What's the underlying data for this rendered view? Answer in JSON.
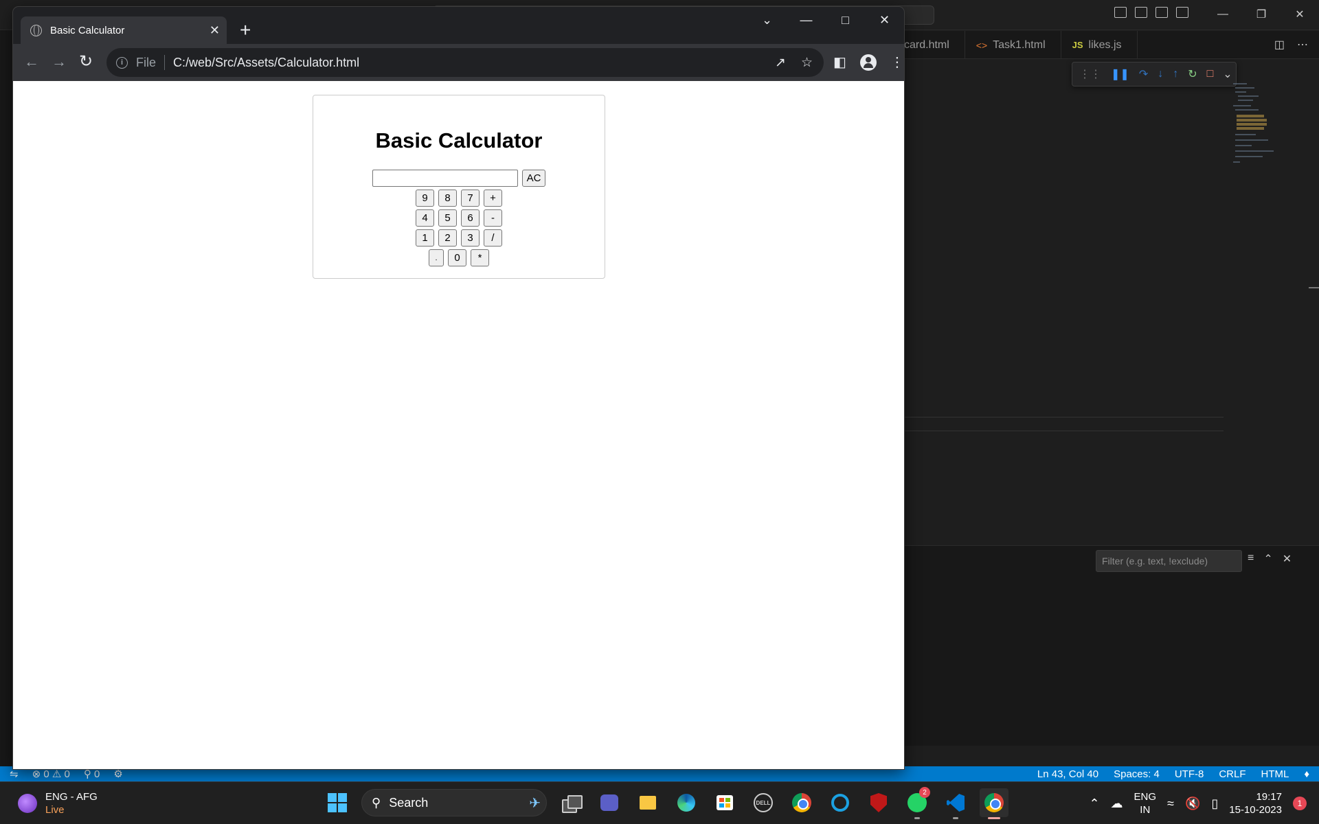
{
  "browser": {
    "tab_title": "Basic Calculator",
    "url_scheme": "File",
    "url": "C:/web/Src/Assets/Calculator.html"
  },
  "calculator": {
    "title": "Basic Calculator",
    "display_value": "",
    "clear_label": "AC",
    "rows": [
      [
        "9",
        "8",
        "7",
        "+"
      ],
      [
        "4",
        "5",
        "6",
        "-"
      ],
      [
        "1",
        "2",
        "3",
        "/"
      ],
      [
        ".",
        "0",
        "*"
      ]
    ]
  },
  "vscode": {
    "tabs": [
      {
        "label": "card.html",
        "icon": "html-file-icon"
      },
      {
        "label": "Task1.html",
        "icon": "html-file-icon"
      },
      {
        "label": "likes.js",
        "icon": "js-file-icon"
      }
    ],
    "filter_placeholder": "Filter (e.g. text, !exclude)",
    "status": {
      "errors": "0",
      "warnings": "0",
      "ports": "0",
      "cursor": "Ln 43, Col 40",
      "spaces": "Spaces: 4",
      "encoding": "UTF-8",
      "eol": "CRLF",
      "language": "HTML"
    }
  },
  "taskbar": {
    "weather_label": "ENG - AFG",
    "weather_status": "Live",
    "search_label": "Search",
    "whatsapp_badge": "2",
    "lang_line1": "ENG",
    "lang_line2": "IN",
    "time": "19:17",
    "date": "15-10-2023",
    "notification_count": "1"
  }
}
